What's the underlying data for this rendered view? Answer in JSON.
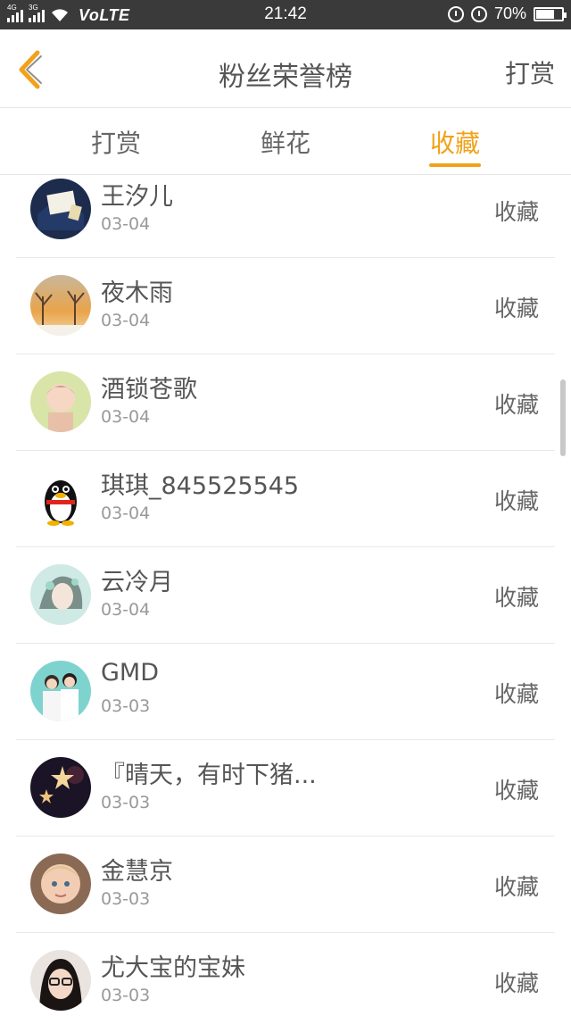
{
  "status_bar": {
    "sim1_label": "4G",
    "sim2_label": "3G",
    "network": "VoLTE",
    "time": "21:42",
    "battery": "70%",
    "battery_level": 0.7
  },
  "header": {
    "title": "粉丝荣誉榜",
    "action": "打赏"
  },
  "tabs": [
    {
      "label": "打赏",
      "active": false
    },
    {
      "label": "鲜花",
      "active": false
    },
    {
      "label": "收藏",
      "active": true
    }
  ],
  "fans": [
    {
      "name": "王汐儿",
      "date": "03-04",
      "action": "收藏",
      "avatar": "envelope-avatar"
    },
    {
      "name": "夜木雨",
      "date": "03-04",
      "action": "收藏",
      "avatar": "sunset-trees-avatar"
    },
    {
      "name": "酒锁苍歌",
      "date": "03-04",
      "action": "收藏",
      "avatar": "anime-boy-avatar"
    },
    {
      "name": "琪琪_845525545",
      "date": "03-04",
      "action": "收藏",
      "avatar": "qq-penguin-avatar"
    },
    {
      "name": "云冷月",
      "date": "03-04",
      "action": "收藏",
      "avatar": "anime-girl-avatar"
    },
    {
      "name": "GMD",
      "date": "03-03",
      "action": "收藏",
      "avatar": "couple-photo-avatar"
    },
    {
      "name": "『晴天，有时下猪...",
      "date": "03-03",
      "action": "收藏",
      "avatar": "stars-avatar"
    },
    {
      "name": "金慧京",
      "date": "03-03",
      "action": "收藏",
      "avatar": "baby-photo-avatar"
    },
    {
      "name": "尤大宝的宝妹",
      "date": "03-03",
      "action": "收藏",
      "avatar": "girl-glasses-avatar"
    }
  ],
  "colors": {
    "accent": "#f0a21a",
    "status_bar": "#3a3a3a",
    "divider": "#e9e9e9"
  }
}
